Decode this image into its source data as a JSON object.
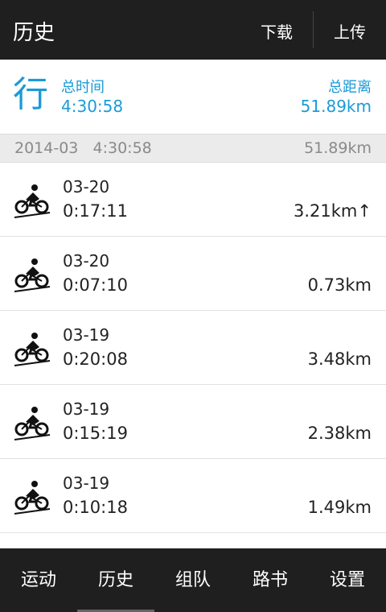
{
  "header": {
    "title": "历史",
    "download_label": "下载",
    "upload_label": "上传"
  },
  "summary": {
    "icon_char": "行",
    "time_label": "总时间",
    "time_value": "4:30:58",
    "distance_label": "总距离",
    "distance_value": "51.89km"
  },
  "month_group": {
    "month": "2014-03",
    "time": "4:30:58",
    "distance": "51.89km"
  },
  "records": [
    {
      "date": "03-20",
      "duration": "0:17:11",
      "distance": "3.21km↑"
    },
    {
      "date": "03-20",
      "duration": "0:07:10",
      "distance": "0.73km"
    },
    {
      "date": "03-19",
      "duration": "0:20:08",
      "distance": "3.48km"
    },
    {
      "date": "03-19",
      "duration": "0:15:19",
      "distance": "2.38km"
    },
    {
      "date": "03-19",
      "duration": "0:10:18",
      "distance": "1.49km"
    }
  ],
  "tabs": [
    {
      "label": "运动"
    },
    {
      "label": "历史"
    },
    {
      "label": "组队"
    },
    {
      "label": "路书"
    },
    {
      "label": "设置"
    }
  ],
  "colors": {
    "accent": "#1a9bd7",
    "bar": "#1f1f1f"
  }
}
